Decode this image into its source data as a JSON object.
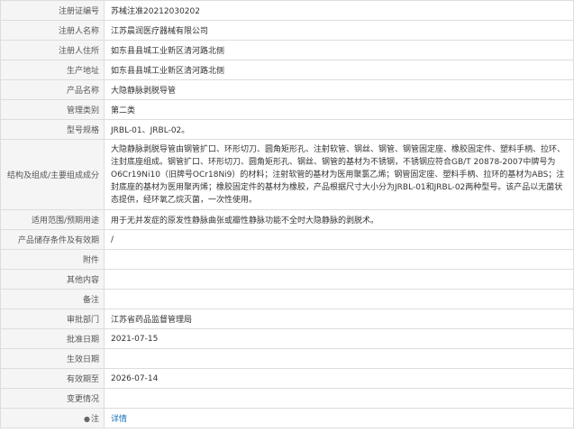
{
  "rows": [
    {
      "label": "注册证编号",
      "value": "苏械注准20212030202"
    },
    {
      "label": "注册人名称",
      "value": "江苏晨润医疗器械有限公司"
    },
    {
      "label": "注册人住所",
      "value": "如东县县城工业新区清河路北侧"
    },
    {
      "label": "生产地址",
      "value": "如东县县城工业新区清河路北侧"
    },
    {
      "label": "产品名称",
      "value": "大隐静脉剥脱导管"
    },
    {
      "label": "管理类别",
      "value": "第二类"
    },
    {
      "label": "型号规格",
      "value": "JRBL-01、JRBL-02。"
    },
    {
      "label": "结构及组成/主要组成成分",
      "value": "大隐静脉剥脱导管由钢管扩口、环形切刀、圆角矩形孔、注射软管、钢丝、钢管、钢管固定座、橡胶固定件、塑料手柄、拉环、注封底座组成。钢管扩口、环形切刀、圆角矩形孔、钢丝、钢管的基材为不锈钢，不锈钢应符合GB/T 20878-2007中牌号为O6Cr19Ni10（旧牌号OCr18Ni9）的材料；注射软管的基材为医用聚氯乙烯；钢管固定座、塑料手柄、拉环的基材为ABS；注封底座的基材为医用聚丙烯；橡胶固定件的基材为橡胶，产品根据尺寸大小分为JRBL-01和JRBL-02两种型号。该产品以无菌状态提供，经环氧乙烷灭菌，一次性使用。"
    },
    {
      "label": "适用范围/预期用途",
      "value": "用于无并发症的原发性静脉曲张或瓣性静脉功能不全时大隐静脉的剥脱术。"
    },
    {
      "label": "产品储存条件及有效期",
      "value": "/"
    },
    {
      "label": "附件",
      "value": ""
    },
    {
      "label": "其他内容",
      "value": ""
    },
    {
      "label": "备注",
      "value": ""
    },
    {
      "label": "审批部门",
      "value": "江苏省药品监督管理局"
    },
    {
      "label": "批准日期",
      "value": "2021-07-15"
    },
    {
      "label": "生效日期",
      "value": ""
    },
    {
      "label": "有效期至",
      "value": "2026-07-14"
    },
    {
      "label": "变更情况",
      "value": ""
    }
  ],
  "note": {
    "icon": "pin-icon",
    "label": "注",
    "link_text": "详情",
    "link_color": "#1a6fb5"
  }
}
